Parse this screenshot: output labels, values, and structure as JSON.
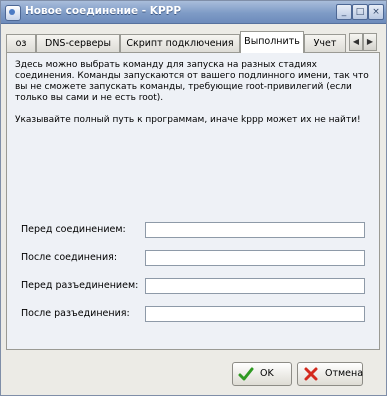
{
  "window": {
    "title": "Новое соединение - KPPP",
    "buttons": [
      "_",
      "□",
      "×"
    ]
  },
  "tabs": {
    "items": [
      {
        "label": "оз"
      },
      {
        "label": "DNS-серверы"
      },
      {
        "label": "Скрипт подключения"
      },
      {
        "label": "Выполнить"
      },
      {
        "label": "Учет"
      }
    ],
    "active_index": 3,
    "scroll_left": "◀",
    "scroll_right": "▶"
  },
  "panel": {
    "description": "Здесь можно выбрать команду для запуска на разных стадиях соединения. Команды запускаются от вашего подлинного имени, так что вы не сможете запускать команды, требующие root-привилегий (если только вы сами и не есть root).\n\nУказывайте полный путь к программам, иначе kppp может их не найти!",
    "fields": [
      {
        "label": "Перед соединением:",
        "value": ""
      },
      {
        "label": "После соединения:",
        "value": ""
      },
      {
        "label": "Перед разъединением:",
        "value": ""
      },
      {
        "label": "После разъединения:",
        "value": ""
      }
    ]
  },
  "footer": {
    "ok_label": "OK",
    "cancel_label": "Отмена",
    "ok_icon": "check-icon",
    "cancel_icon": "cross-icon"
  }
}
